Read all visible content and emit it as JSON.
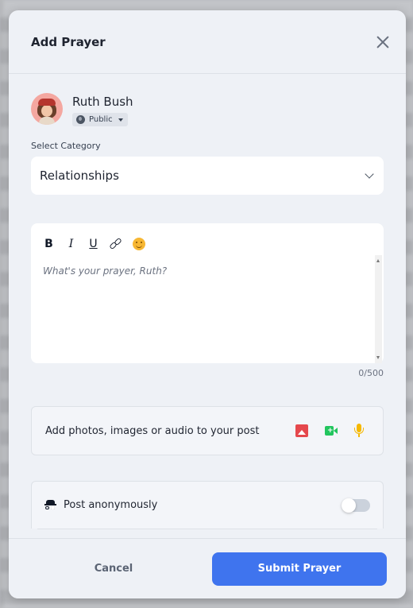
{
  "modal": {
    "title": "Add Prayer"
  },
  "user": {
    "name": "Ruth Bush",
    "privacy": "Public"
  },
  "category": {
    "label": "Select Category",
    "selected": "Relationships"
  },
  "editor": {
    "toolbar": {
      "bold": "B",
      "italic": "I",
      "underline": "U"
    },
    "placeholder": "What's your prayer, Ruth?",
    "char_count": "0/500"
  },
  "media": {
    "text": "Add photos, images or audio to your post"
  },
  "anonymous": {
    "label": "Post anonymously",
    "enabled": false
  },
  "footer": {
    "cancel_label": "Cancel",
    "submit_label": "Submit Prayer"
  },
  "colors": {
    "accent": "#3f74ee",
    "photo_icon": "#e5484d",
    "video_icon": "#22c55e",
    "audio_icon": "#f5b800"
  }
}
